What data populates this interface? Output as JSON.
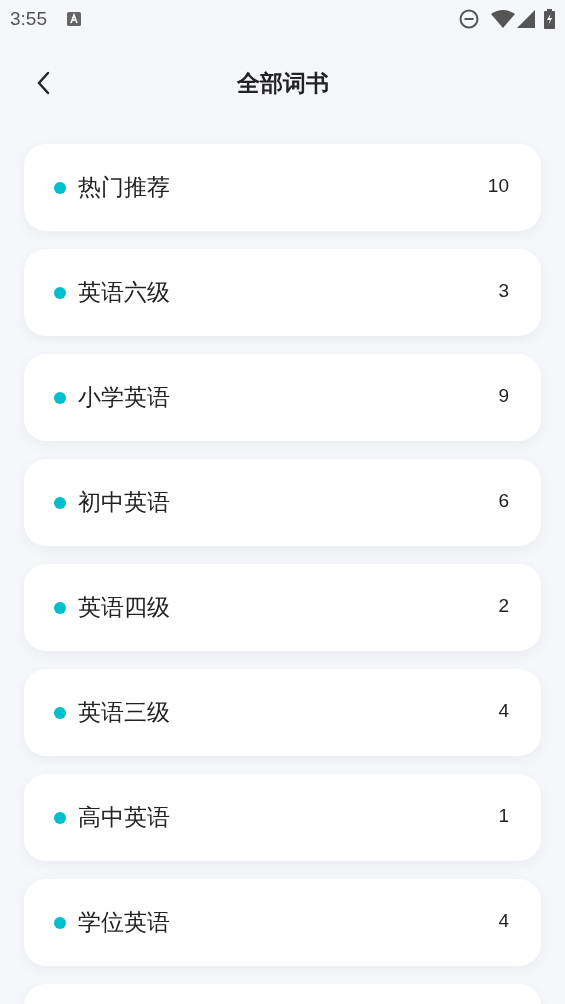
{
  "status_bar": {
    "time": "3:55"
  },
  "header": {
    "title": "全部词书"
  },
  "categories": [
    {
      "name": "热门推荐",
      "count": "10"
    },
    {
      "name": "英语六级",
      "count": "3"
    },
    {
      "name": "小学英语",
      "count": "9"
    },
    {
      "name": "初中英语",
      "count": "6"
    },
    {
      "name": "英语四级",
      "count": "2"
    },
    {
      "name": "英语三级",
      "count": "4"
    },
    {
      "name": "高中英语",
      "count": "1"
    },
    {
      "name": "学位英语",
      "count": "4"
    }
  ]
}
